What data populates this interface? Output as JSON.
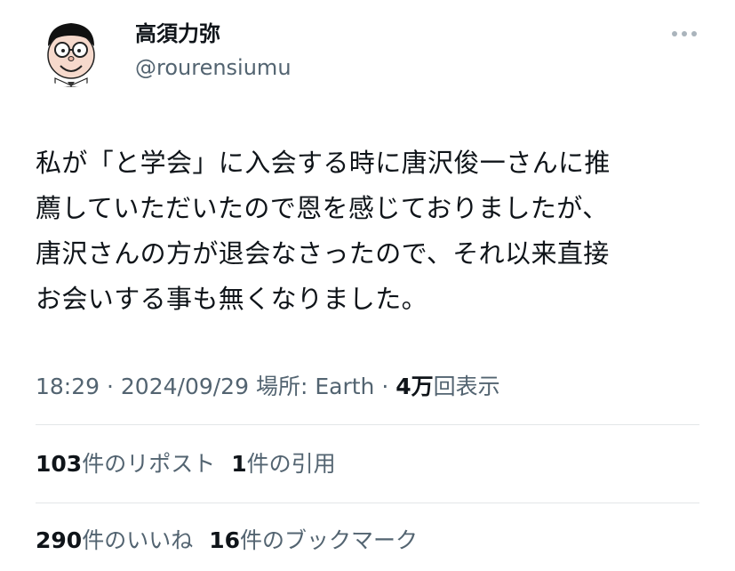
{
  "author": {
    "display_name": "高須力弥",
    "handle": "@rourensiumu"
  },
  "tweet": {
    "text": "私が「と学会」に入会する時に唐沢俊一さんに推\n薦していただいたので恩を感じておりましたが、\n唐沢さんの方が退会なさったので、それ以来直接\nお会いする事も無くなりました。"
  },
  "meta": {
    "time": "18:29",
    "date": "2024/09/29",
    "place_label": "場所: Earth",
    "views_count": "4万",
    "views_label": "回表示",
    "separator": "·"
  },
  "stats": {
    "reposts": {
      "count": "103",
      "label": "件のリポスト"
    },
    "quotes": {
      "count": "1",
      "label": "件の引用"
    },
    "likes": {
      "count": "290",
      "label": "件のいいね"
    },
    "bookmarks": {
      "count": "16",
      "label": "件のブックマーク"
    }
  },
  "icons": {
    "avatar": "cartoon-face-with-glasses-avatar",
    "more": "more-horizontal-icon"
  },
  "colors": {
    "text_primary": "#0f1419",
    "text_secondary": "#536471",
    "divider": "#e3e6e8"
  }
}
